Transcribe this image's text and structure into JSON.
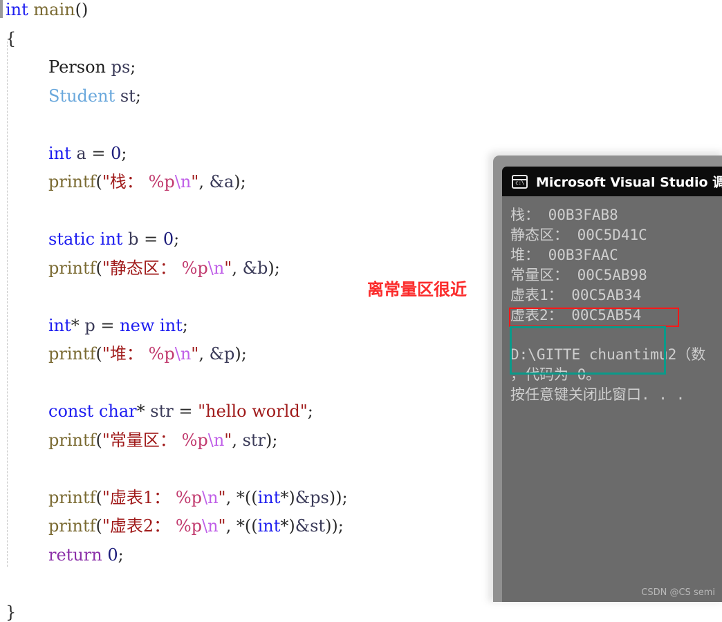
{
  "editor": {
    "language": "cpp",
    "lines": [
      {
        "indent": 0,
        "tokens": [
          {
            "t": "int",
            "c": "kw"
          },
          {
            "t": " ",
            "c": "plain"
          },
          {
            "t": "main",
            "c": "fn"
          },
          {
            "t": "()",
            "c": "plain"
          }
        ]
      },
      {
        "indent": 0,
        "tokens": [
          {
            "t": "{",
            "c": "plain"
          }
        ]
      },
      {
        "indent": 1,
        "tokens": [
          {
            "t": "Person",
            "c": "cls"
          },
          {
            "t": " ",
            "c": "plain"
          },
          {
            "t": "ps",
            "c": "pun"
          },
          {
            "t": ";",
            "c": "plain"
          }
        ]
      },
      {
        "indent": 1,
        "tokens": [
          {
            "t": "Student",
            "c": "typ"
          },
          {
            "t": " ",
            "c": "plain"
          },
          {
            "t": "st",
            "c": "pun"
          },
          {
            "t": ";",
            "c": "plain"
          }
        ]
      },
      {
        "indent": 1,
        "tokens": []
      },
      {
        "indent": 1,
        "tokens": [
          {
            "t": "int",
            "c": "kw"
          },
          {
            "t": " ",
            "c": "plain"
          },
          {
            "t": "a",
            "c": "pun"
          },
          {
            "t": " = ",
            "c": "plain"
          },
          {
            "t": "0",
            "c": "num"
          },
          {
            "t": ";",
            "c": "plain"
          }
        ]
      },
      {
        "indent": 1,
        "tokens": [
          {
            "t": "printf",
            "c": "fn"
          },
          {
            "t": "(",
            "c": "plain"
          },
          {
            "t": "\"栈：",
            "c": "str"
          },
          {
            "t": " ",
            "c": "str"
          },
          {
            "t": "%p",
            "c": "pct"
          },
          {
            "t": "\\n",
            "c": "esc"
          },
          {
            "t": "\"",
            "c": "str"
          },
          {
            "t": ", ",
            "c": "plain"
          },
          {
            "t": "&a",
            "c": "pun"
          },
          {
            "t": ");",
            "c": "plain"
          }
        ]
      },
      {
        "indent": 1,
        "tokens": []
      },
      {
        "indent": 1,
        "tokens": [
          {
            "t": "static",
            "c": "kw"
          },
          {
            "t": " ",
            "c": "plain"
          },
          {
            "t": "int",
            "c": "kw"
          },
          {
            "t": " ",
            "c": "plain"
          },
          {
            "t": "b",
            "c": "pun"
          },
          {
            "t": " = ",
            "c": "plain"
          },
          {
            "t": "0",
            "c": "num"
          },
          {
            "t": ";",
            "c": "plain"
          }
        ]
      },
      {
        "indent": 1,
        "tokens": [
          {
            "t": "printf",
            "c": "fn"
          },
          {
            "t": "(",
            "c": "plain"
          },
          {
            "t": "\"静态区：",
            "c": "str"
          },
          {
            "t": " ",
            "c": "str"
          },
          {
            "t": "%p",
            "c": "pct"
          },
          {
            "t": "\\n",
            "c": "esc"
          },
          {
            "t": "\"",
            "c": "str"
          },
          {
            "t": ", ",
            "c": "plain"
          },
          {
            "t": "&b",
            "c": "pun"
          },
          {
            "t": ");",
            "c": "plain"
          }
        ]
      },
      {
        "indent": 1,
        "tokens": []
      },
      {
        "indent": 1,
        "tokens": [
          {
            "t": "int",
            "c": "kw"
          },
          {
            "t": "* ",
            "c": "plain"
          },
          {
            "t": "p",
            "c": "pun"
          },
          {
            "t": " = ",
            "c": "plain"
          },
          {
            "t": "new",
            "c": "kw"
          },
          {
            "t": " ",
            "c": "plain"
          },
          {
            "t": "int",
            "c": "kw"
          },
          {
            "t": ";",
            "c": "plain"
          }
        ]
      },
      {
        "indent": 1,
        "tokens": [
          {
            "t": "printf",
            "c": "fn"
          },
          {
            "t": "(",
            "c": "plain"
          },
          {
            "t": "\"堆：",
            "c": "str"
          },
          {
            "t": " ",
            "c": "str"
          },
          {
            "t": "%p",
            "c": "pct"
          },
          {
            "t": "\\n",
            "c": "esc"
          },
          {
            "t": "\"",
            "c": "str"
          },
          {
            "t": ", ",
            "c": "plain"
          },
          {
            "t": "&p",
            "c": "pun"
          },
          {
            "t": ");",
            "c": "plain"
          }
        ]
      },
      {
        "indent": 1,
        "tokens": []
      },
      {
        "indent": 1,
        "tokens": [
          {
            "t": "const",
            "c": "kw"
          },
          {
            "t": " ",
            "c": "plain"
          },
          {
            "t": "char",
            "c": "kw"
          },
          {
            "t": "* ",
            "c": "plain"
          },
          {
            "t": "str",
            "c": "pun"
          },
          {
            "t": " = ",
            "c": "plain"
          },
          {
            "t": "\"hello world\"",
            "c": "str"
          },
          {
            "t": ";",
            "c": "plain"
          }
        ]
      },
      {
        "indent": 1,
        "tokens": [
          {
            "t": "printf",
            "c": "fn"
          },
          {
            "t": "(",
            "c": "plain"
          },
          {
            "t": "\"常量区：",
            "c": "str"
          },
          {
            "t": " ",
            "c": "str"
          },
          {
            "t": "%p",
            "c": "pct"
          },
          {
            "t": "\\n",
            "c": "esc"
          },
          {
            "t": "\"",
            "c": "str"
          },
          {
            "t": ", ",
            "c": "plain"
          },
          {
            "t": "str",
            "c": "pun"
          },
          {
            "t": ");",
            "c": "plain"
          }
        ]
      },
      {
        "indent": 1,
        "tokens": []
      },
      {
        "indent": 1,
        "tokens": [
          {
            "t": "printf",
            "c": "fn"
          },
          {
            "t": "(",
            "c": "plain"
          },
          {
            "t": "\"虚表1：",
            "c": "str"
          },
          {
            "t": " ",
            "c": "str"
          },
          {
            "t": "%p",
            "c": "pct"
          },
          {
            "t": "\\n",
            "c": "esc"
          },
          {
            "t": "\"",
            "c": "str"
          },
          {
            "t": ", *((",
            "c": "plain"
          },
          {
            "t": "int",
            "c": "kw"
          },
          {
            "t": "*)",
            "c": "plain"
          },
          {
            "t": "&ps",
            "c": "pun"
          },
          {
            "t": "));",
            "c": "plain"
          }
        ]
      },
      {
        "indent": 1,
        "tokens": [
          {
            "t": "printf",
            "c": "fn"
          },
          {
            "t": "(",
            "c": "plain"
          },
          {
            "t": "\"虚表2：",
            "c": "str"
          },
          {
            "t": " ",
            "c": "str"
          },
          {
            "t": "%p",
            "c": "pct"
          },
          {
            "t": "\\n",
            "c": "esc"
          },
          {
            "t": "\"",
            "c": "str"
          },
          {
            "t": ", *((",
            "c": "plain"
          },
          {
            "t": "int",
            "c": "kw"
          },
          {
            "t": "*)",
            "c": "plain"
          },
          {
            "t": "&st",
            "c": "pun"
          },
          {
            "t": "));",
            "c": "plain"
          }
        ]
      },
      {
        "indent": 1,
        "tokens": [
          {
            "t": "return",
            "c": "kw2"
          },
          {
            "t": " ",
            "c": "plain"
          },
          {
            "t": "0",
            "c": "num"
          },
          {
            "t": ";",
            "c": "plain"
          }
        ]
      },
      {
        "indent": 0,
        "tokens": []
      },
      {
        "indent": 0,
        "tokens": [
          {
            "t": "}",
            "c": "plain"
          }
        ]
      }
    ]
  },
  "annotation": {
    "text": "离常量区很近",
    "color": "#fb2b2b"
  },
  "console": {
    "icon": "console-cmd-icon",
    "icon_glyph": "c:\\",
    "title": "Microsoft Visual Studio 调试控",
    "output_lines": [
      "栈： 00B3FAB8",
      "静态区： 00C5D41C",
      "堆： 00B3FAAC",
      "常量区： 00C5AB98",
      "虚表1： 00C5AB34",
      "虚表2： 00C5AB54"
    ],
    "footer_lines": [
      "D:\\GITTE chuantimu2（数",
      "，代码为 0。",
      "按任意键关闭此窗口. . ."
    ],
    "highlight_const": {
      "label": "常量区-highlight",
      "color": "#f81818"
    },
    "highlight_vtable": {
      "label": "虚表-highlight",
      "color": "#0a9a8a"
    }
  },
  "watermark": {
    "text": "CSDN @CS semi"
  }
}
